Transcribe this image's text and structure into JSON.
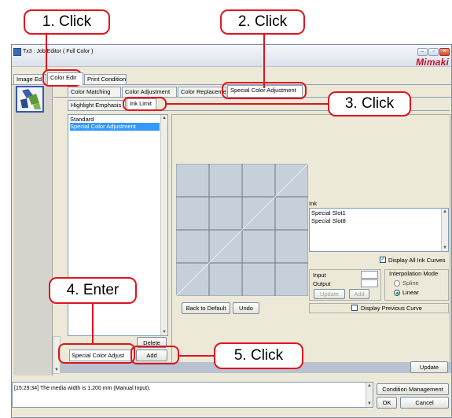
{
  "window": {
    "title": "Tx3 : Job Editor ( Full Color )",
    "logo_text": "Mimaki",
    "icon_names": {
      "app": "app-icon",
      "minimize": "minimize-icon",
      "maximize": "maximize-icon",
      "close": "close-icon"
    }
  },
  "callouts": {
    "step1": "1. Click",
    "step2": "2. Click",
    "step3": "3. Click",
    "step4": "4. Enter",
    "step5": "5. Click"
  },
  "main_tabs": [
    "Image Ed",
    "Color Edit",
    "Print Condition"
  ],
  "sub_tabs": [
    "Color Matching",
    "Color Adjustment",
    "Color Replacement",
    "Special Color Adjustment"
  ],
  "inner_tabs": [
    "Highlight Emphasis",
    "Ink Limit"
  ],
  "preset_list": {
    "items": [
      "Standard",
      "Special Color Adjustment"
    ],
    "selected_index": 1
  },
  "buttons": {
    "delete": "Delete",
    "add": "Add",
    "back_to_default": "Back to Default",
    "undo": "Undo",
    "point_update": "Update",
    "point_add": "Add",
    "main_update": "Update",
    "condition_management": "Condition Management",
    "ok": "OK",
    "cancel": "Cancel"
  },
  "name_input_value": "Special Color Adjust",
  "ink_group": {
    "label": "Ink",
    "items": [
      "Special Slot1",
      "Special Slot8"
    ],
    "display_all_label": "Display All Ink Curves",
    "display_all_checked": true
  },
  "point_group": {
    "input_label": "Input",
    "output_label": "Output"
  },
  "interpolation": {
    "label": "Interpolation Mode",
    "options": [
      "Spline",
      "Linear"
    ],
    "selected": "Linear"
  },
  "display_previous": {
    "label": "Display Previous Curve",
    "checked": false
  },
  "log_message": "[15:29:34] The media width is 1,200 mm (Manual Input).",
  "colors": {
    "callout_red": "#e0141e",
    "selection_blue": "#3399ff",
    "graph_bg": "#c6d0da"
  }
}
